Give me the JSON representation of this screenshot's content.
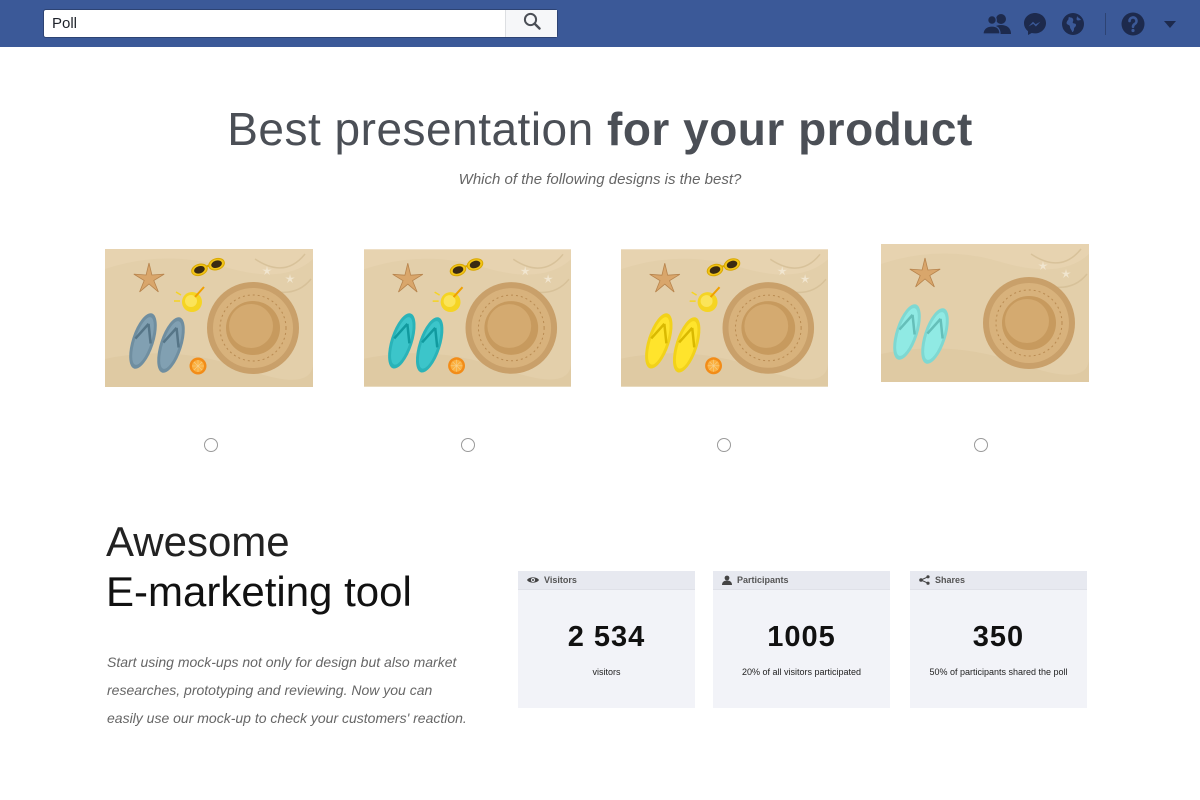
{
  "topbar": {
    "search": {
      "value": "Poll",
      "placeholder": "Search"
    },
    "icons": [
      "search-icon",
      "friends-icon",
      "messenger-icon",
      "globe-icon",
      "help-icon",
      "caret-down-icon"
    ],
    "color": "#3b5998"
  },
  "hero": {
    "title_light": "Best presentation",
    "title_bold": "for your product",
    "subtitle": "Which of the following designs is the best?"
  },
  "designs": [
    {
      "flipflop_color": "#6f8ea0",
      "sunglasses": true,
      "juice": true,
      "orange": true,
      "selected": false
    },
    {
      "flipflop_color": "#2ab3b8",
      "sunglasses": true,
      "juice": true,
      "orange": true,
      "selected": false
    },
    {
      "flipflop_color": "#f2d21a",
      "sunglasses": true,
      "juice": true,
      "orange": true,
      "selected": false
    },
    {
      "flipflop_color": "#7ed8d2",
      "sunglasses": false,
      "juice": false,
      "orange": false,
      "selected": false
    }
  ],
  "marketing": {
    "title_light": "Awesome",
    "title_bold": "E-marketing tool",
    "body": "Start using mock-ups not only for design but also market researches, prototyping and reviewing. Now you can easily use our mock-up to check your customers' reaction."
  },
  "stats": [
    {
      "label": "Visitors",
      "icon": "eye-icon",
      "value": "2 534",
      "caption": "visitors"
    },
    {
      "label": "Participants",
      "icon": "person-icon",
      "value": "1005",
      "caption": "20% of all visitors participated"
    },
    {
      "label": "Shares",
      "icon": "share-icon",
      "value": "350",
      "caption": "50% of participants shared the poll"
    }
  ]
}
